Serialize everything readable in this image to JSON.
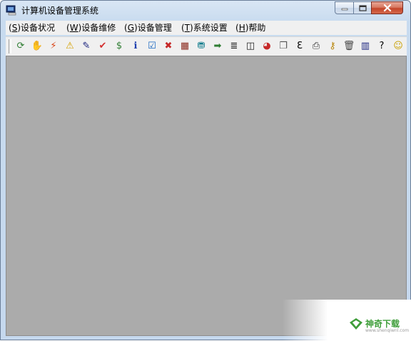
{
  "window": {
    "title": "计算机设备管理系统"
  },
  "menu": [
    {
      "mnemonic": "S",
      "label": "设备状况"
    },
    {
      "mnemonic": "W",
      "label": "设备维修"
    },
    {
      "mnemonic": "G",
      "label": "设备管理"
    },
    {
      "mnemonic": "T",
      "label": "系统设置"
    },
    {
      "mnemonic": "H",
      "label": "帮助"
    }
  ],
  "toolbar": [
    {
      "icon": "refresh-icon",
      "glyph": "⟳",
      "color": "#2e7d32"
    },
    {
      "icon": "stop-hand-icon",
      "glyph": "✋",
      "color": "#c62828"
    },
    {
      "icon": "lightning-icon",
      "glyph": "⚡",
      "color": "#d84315"
    },
    {
      "icon": "warning-icon",
      "glyph": "⚠",
      "color": "#d4a000"
    },
    {
      "icon": "checklist-icon",
      "glyph": "✎",
      "color": "#1a237e"
    },
    {
      "icon": "checkmark-icon",
      "glyph": "✔",
      "color": "#d32f2f"
    },
    {
      "icon": "money-bag-icon",
      "glyph": "$",
      "color": "#2e7d32"
    },
    {
      "icon": "info-icon",
      "glyph": "ℹ",
      "color": "#1e40af"
    },
    {
      "icon": "approve-icon",
      "glyph": "☑",
      "color": "#1565c0"
    },
    {
      "icon": "delete-icon",
      "glyph": "✖",
      "color": "#c62828"
    },
    {
      "icon": "grid-icon",
      "glyph": "▦",
      "color": "#8b2b1f"
    },
    {
      "icon": "database-icon",
      "glyph": "⛃",
      "color": "#0d7a8a"
    },
    {
      "icon": "next-arrow-icon",
      "glyph": "➡",
      "color": "#2e7d32"
    },
    {
      "icon": "list-icon",
      "glyph": "≣",
      "color": "#222222"
    },
    {
      "icon": "columns-icon",
      "glyph": "◫",
      "color": "#222222"
    },
    {
      "icon": "pie-chart-icon",
      "glyph": "◕",
      "color": "#c62828"
    },
    {
      "icon": "tags-icon",
      "glyph": "❐",
      "color": "#555555"
    },
    {
      "icon": "question-e-icon",
      "glyph": "Ɛ",
      "color": "#000000"
    },
    {
      "icon": "printer-icon",
      "glyph": "⎙",
      "color": "#333333"
    },
    {
      "icon": "key-icon",
      "glyph": "⚷",
      "color": "#b8860b"
    },
    {
      "icon": "trash-icon",
      "glyph": "🗑",
      "color": "#444444"
    },
    {
      "icon": "bar-chart-icon",
      "glyph": "▥",
      "color": "#1a237e"
    },
    {
      "icon": "help-icon",
      "glyph": "?",
      "color": "#000000"
    },
    {
      "icon": "smiley-icon",
      "glyph": "☺",
      "color": "#c9a000"
    }
  ],
  "watermark": {
    "text": "神奇下载",
    "sub": "www.shenqiwnl.com"
  }
}
